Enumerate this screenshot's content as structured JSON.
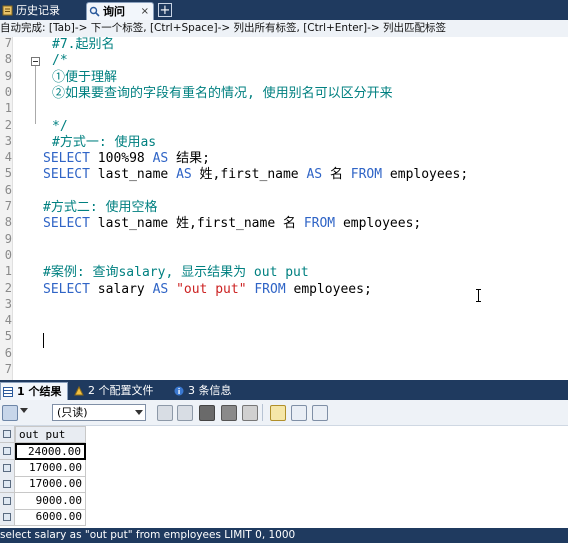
{
  "tabs": {
    "history_label": "历史记录",
    "query_label": "询问",
    "close_glyph": "×",
    "add_glyph": "+"
  },
  "hint_bar": {
    "text": "自动完成: [Tab]-> 下一个标签, [Ctrl+Space]-> 列出所有标签, [Ctrl+Enter]-> 列出匹配标签"
  },
  "editor": {
    "line_numbers": [
      "7",
      "8",
      "9",
      "0",
      "1",
      "2",
      "3",
      "4",
      "5",
      "6",
      "7",
      "8",
      "9",
      "0",
      "1",
      "2",
      "3",
      "4",
      "5",
      "6",
      "7"
    ],
    "lines": [
      {
        "indent": "  ",
        "segments": [
          {
            "t": "#7.起别名",
            "c": "cmt"
          }
        ]
      },
      {
        "indent": "  ",
        "segments": [
          {
            "t": "/*",
            "c": "cmt"
          }
        ]
      },
      {
        "indent": "  ",
        "segments": [
          {
            "t": "①便于理解",
            "c": "cmt"
          }
        ]
      },
      {
        "indent": "  ",
        "segments": [
          {
            "t": "②如果要查询的字段有重名的情况, 使用别名可以区分开来",
            "c": "cmt"
          }
        ]
      },
      {
        "indent": "",
        "segments": []
      },
      {
        "indent": "  ",
        "segments": [
          {
            "t": "*/",
            "c": "cmt"
          }
        ]
      },
      {
        "indent": "  ",
        "segments": [
          {
            "t": "#方式一: 使用as",
            "c": "cmt"
          }
        ]
      },
      {
        "indent": "",
        "segments": [
          {
            "t": "SELECT",
            "c": "kw"
          },
          {
            "t": " 100%98 ",
            "c": "plain"
          },
          {
            "t": "AS",
            "c": "kw"
          },
          {
            "t": " 结果;",
            "c": "plain"
          }
        ]
      },
      {
        "indent": "",
        "segments": [
          {
            "t": "SELECT",
            "c": "kw"
          },
          {
            "t": " last_name ",
            "c": "plain"
          },
          {
            "t": "AS",
            "c": "kw"
          },
          {
            "t": " 姓,first_name ",
            "c": "plain"
          },
          {
            "t": "AS",
            "c": "kw"
          },
          {
            "t": " 名 ",
            "c": "plain"
          },
          {
            "t": "FROM",
            "c": "kw"
          },
          {
            "t": " employees;",
            "c": "plain"
          }
        ]
      },
      {
        "indent": "",
        "segments": []
      },
      {
        "indent": "",
        "segments": [
          {
            "t": "#方式二: 使用空格",
            "c": "cmt"
          }
        ]
      },
      {
        "indent": "",
        "segments": [
          {
            "t": "SELECT",
            "c": "kw"
          },
          {
            "t": " last_name 姓,first_name 名 ",
            "c": "plain"
          },
          {
            "t": "FROM",
            "c": "kw"
          },
          {
            "t": " employees;",
            "c": "plain"
          }
        ]
      },
      {
        "indent": "",
        "segments": []
      },
      {
        "indent": "",
        "segments": []
      },
      {
        "indent": "",
        "segments": [
          {
            "t": "#案例: 查询salary, 显示结果为 out put",
            "c": "cmt"
          }
        ]
      },
      {
        "indent": "",
        "segments": [
          {
            "t": "SELECT",
            "c": "kw"
          },
          {
            "t": " salary ",
            "c": "plain"
          },
          {
            "t": "AS",
            "c": "kw"
          },
          {
            "t": " ",
            "c": "plain"
          },
          {
            "t": "\"out put\"",
            "c": "str"
          },
          {
            "t": " ",
            "c": "plain"
          },
          {
            "t": "FROM",
            "c": "kw"
          },
          {
            "t": " employees;",
            "c": "plain"
          }
        ]
      },
      {
        "indent": "",
        "segments": []
      },
      {
        "indent": "",
        "segments": []
      },
      {
        "indent": "",
        "segments": []
      },
      {
        "indent": "",
        "segments": []
      },
      {
        "indent": "",
        "segments": []
      }
    ]
  },
  "result_tabs": {
    "results_label": "1 个结果",
    "profile_label": "2 个配置文件",
    "info_label": "3 条信息"
  },
  "result_toolbar": {
    "mode_select_value": "(只读)"
  },
  "grid": {
    "column_header": "out put",
    "rows": [
      "24000.00",
      "17000.00",
      "17000.00",
      "9000.00",
      "6000.00"
    ]
  },
  "status_bar": {
    "text": "select salary as \"out put\" from employees LIMIT 0, 1000"
  },
  "colors": {
    "chrome_dark": "#1f3a5f",
    "comment": "#008080",
    "keyword": "#2f64c6",
    "string": "#cc2222"
  }
}
